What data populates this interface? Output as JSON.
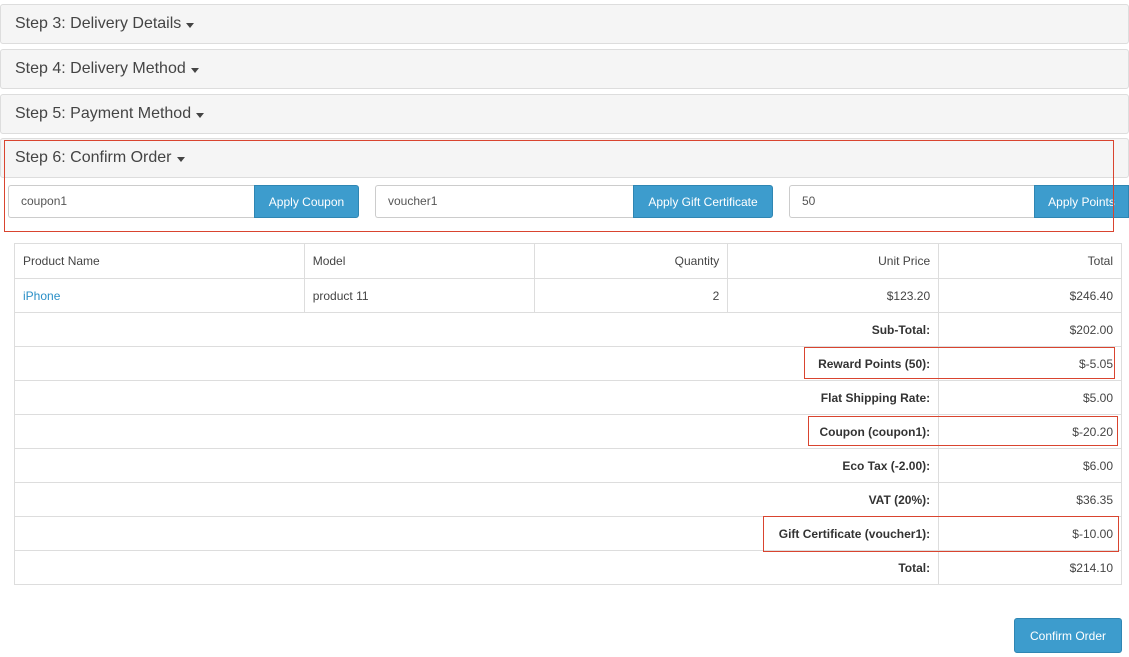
{
  "steps": {
    "step3": "Step 3: Delivery Details",
    "step4": "Step 4: Delivery Method",
    "step5": "Step 5: Payment Method",
    "step6": "Step 6: Confirm Order"
  },
  "coupon": {
    "value": "coupon1",
    "button": "Apply Coupon"
  },
  "voucher": {
    "value": "voucher1",
    "button": "Apply Gift Certificate"
  },
  "reward": {
    "value": "50",
    "button": "Apply Points"
  },
  "table": {
    "headers": [
      "Product Name",
      "Model",
      "Quantity",
      "Unit Price",
      "Total"
    ],
    "product": {
      "name": "iPhone",
      "model": "product 11",
      "quantity": "2",
      "unit_price": "$123.20",
      "total": "$246.40"
    },
    "totals": [
      {
        "label": "Sub-Total:",
        "value": "$202.00"
      },
      {
        "label": "Reward Points (50):",
        "value": "$-5.05"
      },
      {
        "label": "Flat Shipping Rate:",
        "value": "$5.00"
      },
      {
        "label": "Coupon (coupon1):",
        "value": "$-20.20"
      },
      {
        "label": "Eco Tax (-2.00):",
        "value": "$6.00"
      },
      {
        "label": "VAT (20%):",
        "value": "$36.35"
      },
      {
        "label": "Gift Certificate (voucher1):",
        "value": "$-10.00"
      },
      {
        "label": "Total:",
        "value": "$214.10"
      }
    ]
  },
  "confirm_button": "Confirm Order",
  "colors": {
    "accent": "#3d9ccd",
    "highlight": "#d9442f",
    "link": "#2a8fc7"
  }
}
